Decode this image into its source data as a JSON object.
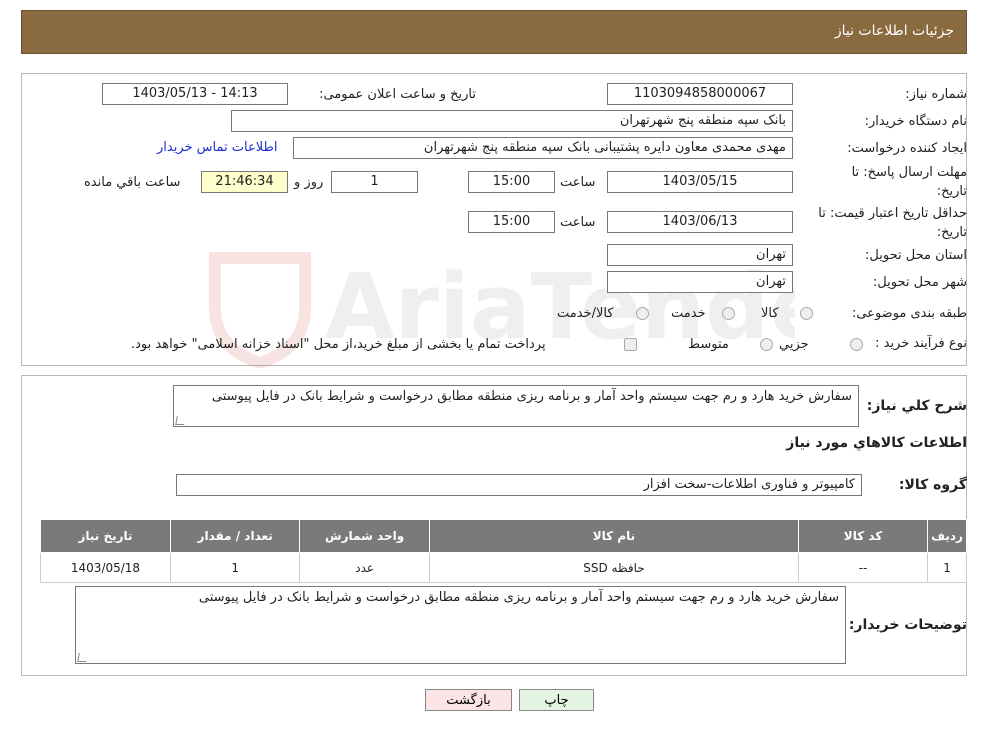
{
  "header": {
    "title": "جزئیات اطلاعات نیاز"
  },
  "labels": {
    "need_number": "شماره نیاز:",
    "announce_datetime": "تاریخ و ساعت اعلان عمومی:",
    "buyer_org": "نام دستگاه خریدار:",
    "requester": "ایجاد کننده درخواست:",
    "contact_link": "اطلاعات تماس خریدار",
    "reply_deadline_line1": "مهلت ارسال پاسخ: تا",
    "reply_deadline_line2": "تاریخ:",
    "hour": "ساعت",
    "day_and": "روز و",
    "time_remaining": "ساعت باقي مانده",
    "price_validity_line1": "حداقل تاریخ اعتبار قیمت: تا",
    "price_validity_line2": "تاریخ:",
    "hour2": "ساعت",
    "delivery_province": "استان محل تحویل:",
    "delivery_city": "شهر محل تحویل:",
    "category": "طبقه بندی موضوعی:",
    "category_goods": "کالا",
    "category_service": "خدمت",
    "category_goods_service": "کالا/خدمت",
    "purchase_type": "نوع فرآیند خرید :",
    "purchase_partial": "جزیي",
    "purchase_medium": "متوسط",
    "payment_note": "پرداخت تمام یا بخشی از مبلغ خرید،از محل \"اسناد خزانه اسلامی\" خواهد بود.",
    "general_desc": "شرح کلي نياز:",
    "goods_info": "اطلاعات کالاهاي مورد نياز",
    "goods_group": "گروه کالا:",
    "buyer_notes": "توضیحات خریدار:"
  },
  "values": {
    "need_number": "1103094858000067",
    "announce_datetime": "1403/05/13 - 14:13",
    "buyer_org": "بانک سپه منطقه پنج شهرتهران",
    "requester": "مهدی محمدی معاون دایره پشتیبانی بانک سپه منطقه پنج شهرتهران",
    "reply_date": "1403/05/15",
    "reply_time": "15:00",
    "days": "1",
    "remaining": "21:46:34",
    "validity_date": "1403/06/13",
    "validity_time": "15:00",
    "province": "تهران",
    "city": "تهران",
    "general_desc": "سفارش خرید هارد و رم جهت سیستم واحد آمار و برنامه ریزی منطقه مطابق درخواست و شرایط بانک در فایل پیوستی",
    "goods_group": "کامپیوتر و فناوری اطلاعات-سخت افزار",
    "buyer_notes": "سفارش خرید هارد و رم جهت سیستم واحد آمار و برنامه ریزی منطقه مطابق درخواست و شرایط بانک در فایل پیوستی"
  },
  "table": {
    "headers": {
      "row": "ردیف",
      "code": "کد کالا",
      "name": "نام کالا",
      "unit": "واحد شمارش",
      "qty": "تعداد / مقدار",
      "date": "تاریخ نیاز"
    },
    "rows": [
      {
        "row": "1",
        "code": "--",
        "name": "حافظه SSD",
        "unit": "عدد",
        "qty": "1",
        "date": "1403/05/18"
      }
    ]
  },
  "buttons": {
    "print": "چاپ",
    "back": "بازگشت"
  },
  "watermark": {
    "text": "AriaTender.neT"
  },
  "colors": {
    "header": "#8a6a3f",
    "table_header": "#7a7a7a",
    "back_button": "#fde4e4",
    "print_button": "#e4f5e4",
    "remaining_bg": "#ffffcc"
  }
}
